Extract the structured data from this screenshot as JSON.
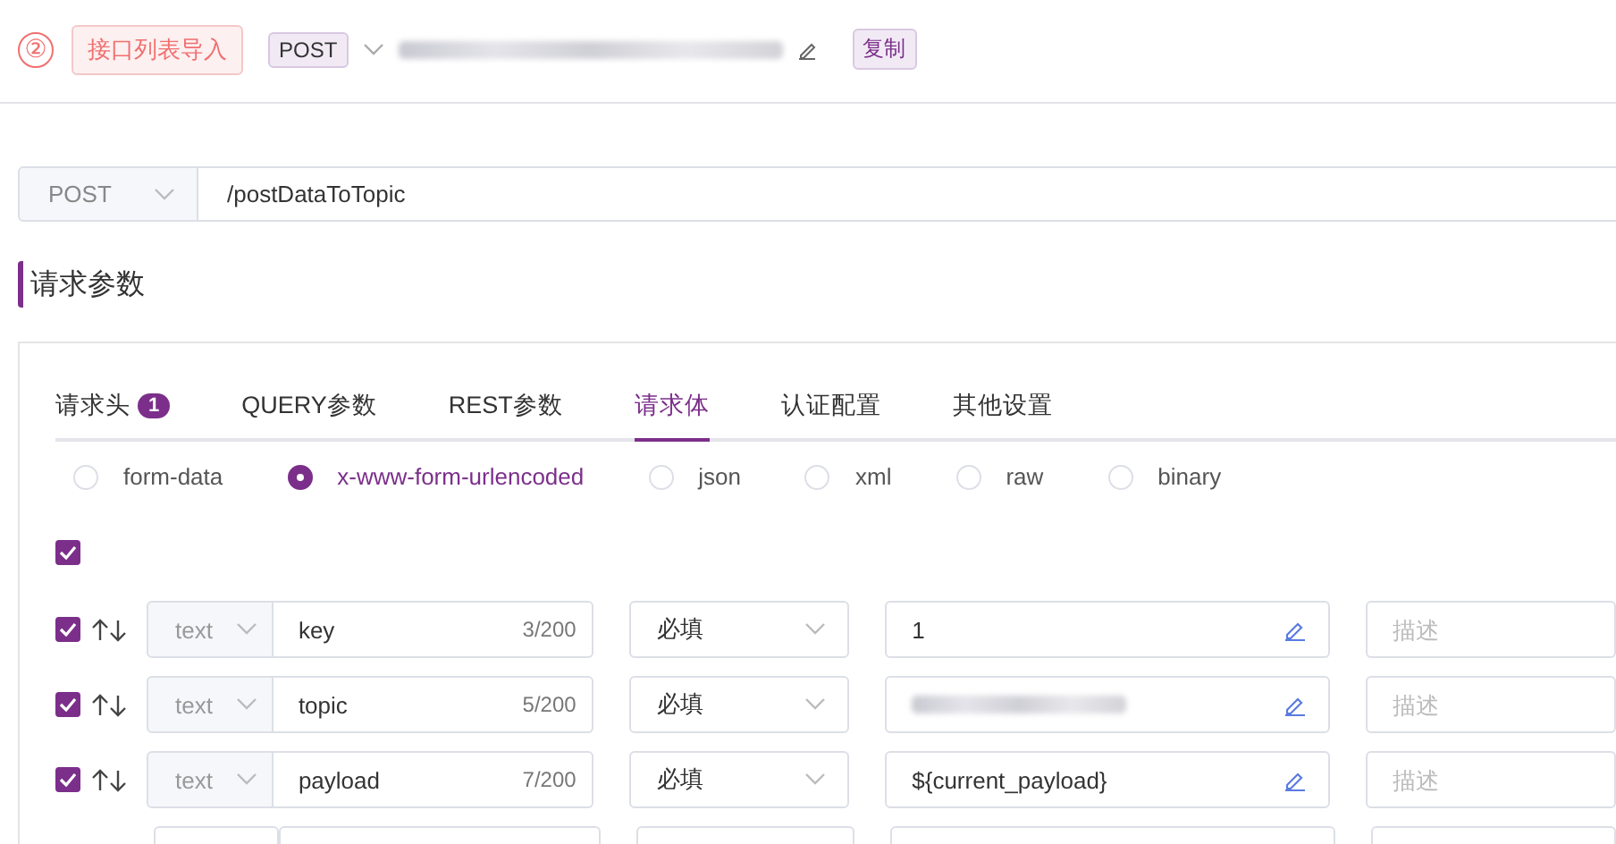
{
  "step": {
    "number": "②",
    "import_button": "接口列表导入",
    "method_badge": "POST",
    "copy_button": "复制"
  },
  "request": {
    "method": "POST",
    "path": "/postDataToTopic"
  },
  "section_title": "请求参数",
  "tabs": [
    {
      "label": "请求头",
      "badge": "1",
      "selected": false
    },
    {
      "label": "QUERY参数",
      "selected": false
    },
    {
      "label": "REST参数",
      "selected": false
    },
    {
      "label": "请求体",
      "selected": true
    },
    {
      "label": "认证配置",
      "selected": false
    },
    {
      "label": "其他设置",
      "selected": false
    }
  ],
  "body_types": [
    {
      "label": "form-data",
      "selected": false
    },
    {
      "label": "x-www-form-urlencoded",
      "selected": true
    },
    {
      "label": "json",
      "selected": false
    },
    {
      "label": "xml",
      "selected": false
    },
    {
      "label": "raw",
      "selected": false
    },
    {
      "label": "binary",
      "selected": false
    }
  ],
  "select_all_checked": true,
  "params": [
    {
      "checked": true,
      "type": "text",
      "key": "key",
      "count": "3/200",
      "required": "必填",
      "value": "1",
      "value_redacted": false,
      "description_placeholder": "描述"
    },
    {
      "checked": true,
      "type": "text",
      "key": "topic",
      "count": "5/200",
      "required": "必填",
      "value_redacted": true,
      "description_placeholder": "描述"
    },
    {
      "checked": true,
      "type": "text",
      "key": "payload",
      "count": "7/200",
      "required": "必填",
      "value": "${current_payload}",
      "value_redacted": false,
      "description_placeholder": "描述"
    }
  ]
}
